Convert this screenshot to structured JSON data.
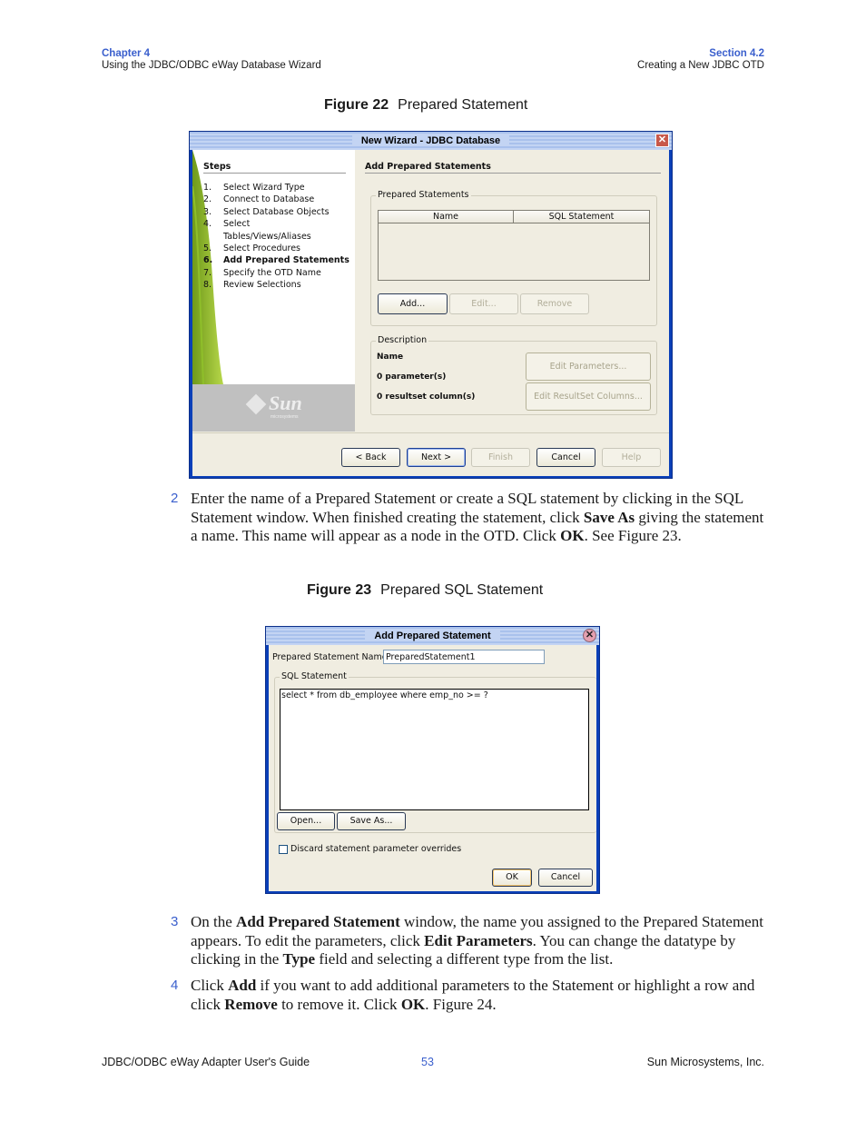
{
  "header": {
    "chapter": "Chapter 4",
    "chapter_title": "Using the JDBC/ODBC eWay Database Wizard",
    "section": "Section 4.2",
    "section_title": "Creating a New JDBC OTD"
  },
  "figure22": {
    "label": "Figure 22",
    "title": "Prepared Statement",
    "window": {
      "title": "New Wizard - JDBC Database",
      "steps_heading": "Steps",
      "steps": [
        {
          "num": "1.",
          "label": "Select Wizard Type",
          "current": false
        },
        {
          "num": "2.",
          "label": "Connect to Database",
          "current": false
        },
        {
          "num": "3.",
          "label": "Select Database Objects",
          "current": false
        },
        {
          "num": "4.",
          "label": "Select",
          "current": false
        },
        {
          "num": "",
          "label": "Tables/Views/Aliases",
          "current": false
        },
        {
          "num": "5.",
          "label": "Select Procedures",
          "current": false
        },
        {
          "num": "6.",
          "label": "Add Prepared Statements",
          "current": true
        },
        {
          "num": "7.",
          "label": "Specify the OTD Name",
          "current": false
        },
        {
          "num": "8.",
          "label": "Review Selections",
          "current": false
        }
      ],
      "logo_text": "Sun",
      "logo_sub": "microsystems",
      "panel_title": "Add Prepared Statements",
      "prepared_group": {
        "legend": "Prepared Statements",
        "columns": [
          "Name",
          "SQL Statement"
        ],
        "rows": [],
        "add": "Add...",
        "edit": "Edit...",
        "remove": "Remove"
      },
      "description_group": {
        "legend": "Description",
        "name": "Name",
        "params": "0 parameter(s)",
        "resultset": "0 resultset column(s)",
        "edit_params": "Edit Parameters...",
        "edit_resultset": "Edit ResultSet Columns..."
      },
      "buttons": {
        "back": "< Back",
        "next": "Next >",
        "finish": "Finish",
        "cancel": "Cancel",
        "help": "Help"
      }
    }
  },
  "step2": {
    "num": "2",
    "t1": "Enter the name of a Prepared Statement or create a SQL statement by clicking in the SQL Statement window. When finished creating the statement, click ",
    "b1": "Save As",
    "t2": " giving the statement a name. This name will appear as a node in the OTD. Click ",
    "b2": "OK",
    "t3": ". See Figure 23."
  },
  "figure23": {
    "label": "Figure 23",
    "title": "Prepared SQL Statement",
    "window": {
      "title": "Add Prepared Statement",
      "name_label": "Prepared Statement Name:",
      "name_value": "PreparedStatement1",
      "sql_legend": "SQL Statement",
      "sql_value": "select * from db_employee where emp_no >= ?",
      "open": "Open...",
      "save_as": "Save As...",
      "discard_label": "Discard statement parameter overrides",
      "discard_checked": false,
      "ok": "OK",
      "cancel": "Cancel"
    }
  },
  "step3": {
    "num": "3",
    "t1": "On the ",
    "b1": "Add Prepared Statement",
    "t2": " window, the name you assigned to the Prepared Statement appears. To edit the parameters, click ",
    "b2": "Edit Parameters",
    "t3": ". You can change the datatype by clicking in the ",
    "b3": "Type",
    "t4": " field and selecting a different type from the list."
  },
  "step4": {
    "num": "4",
    "t1": "Click ",
    "b1": "Add",
    "t2": " if you want to add additional parameters to the Statement or highlight a row and click ",
    "b2": "Remove",
    "t3": " to remove it. Click ",
    "b3": "OK",
    "t4": ". Figure 24."
  },
  "footer": {
    "guide": "JDBC/ODBC eWay Adapter User's Guide",
    "page": "53",
    "company": "Sun Microsystems, Inc."
  }
}
